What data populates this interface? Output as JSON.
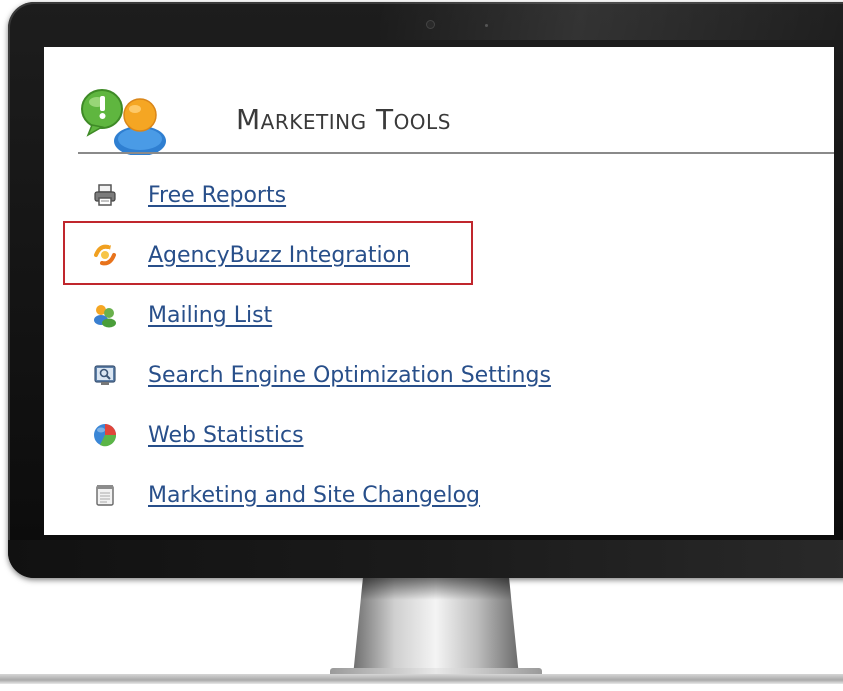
{
  "page": {
    "title": "Marketing Tools"
  },
  "menu": {
    "items": [
      {
        "label": "Free Reports",
        "icon": "printer-icon"
      },
      {
        "label": "AgencyBuzz Integration",
        "icon": "agencybuzz-icon",
        "highlighted": true
      },
      {
        "label": "Mailing List",
        "icon": "users-icon"
      },
      {
        "label": "Search Engine Optimization Settings",
        "icon": "seo-monitor-icon"
      },
      {
        "label": "Web Statistics",
        "icon": "pie-chart-icon"
      },
      {
        "label": "Marketing and Site Changelog",
        "icon": "notepad-icon"
      }
    ]
  },
  "colors": {
    "link": "#284f8a",
    "highlight_border": "#c0262d",
    "title": "#3a3a3a"
  }
}
